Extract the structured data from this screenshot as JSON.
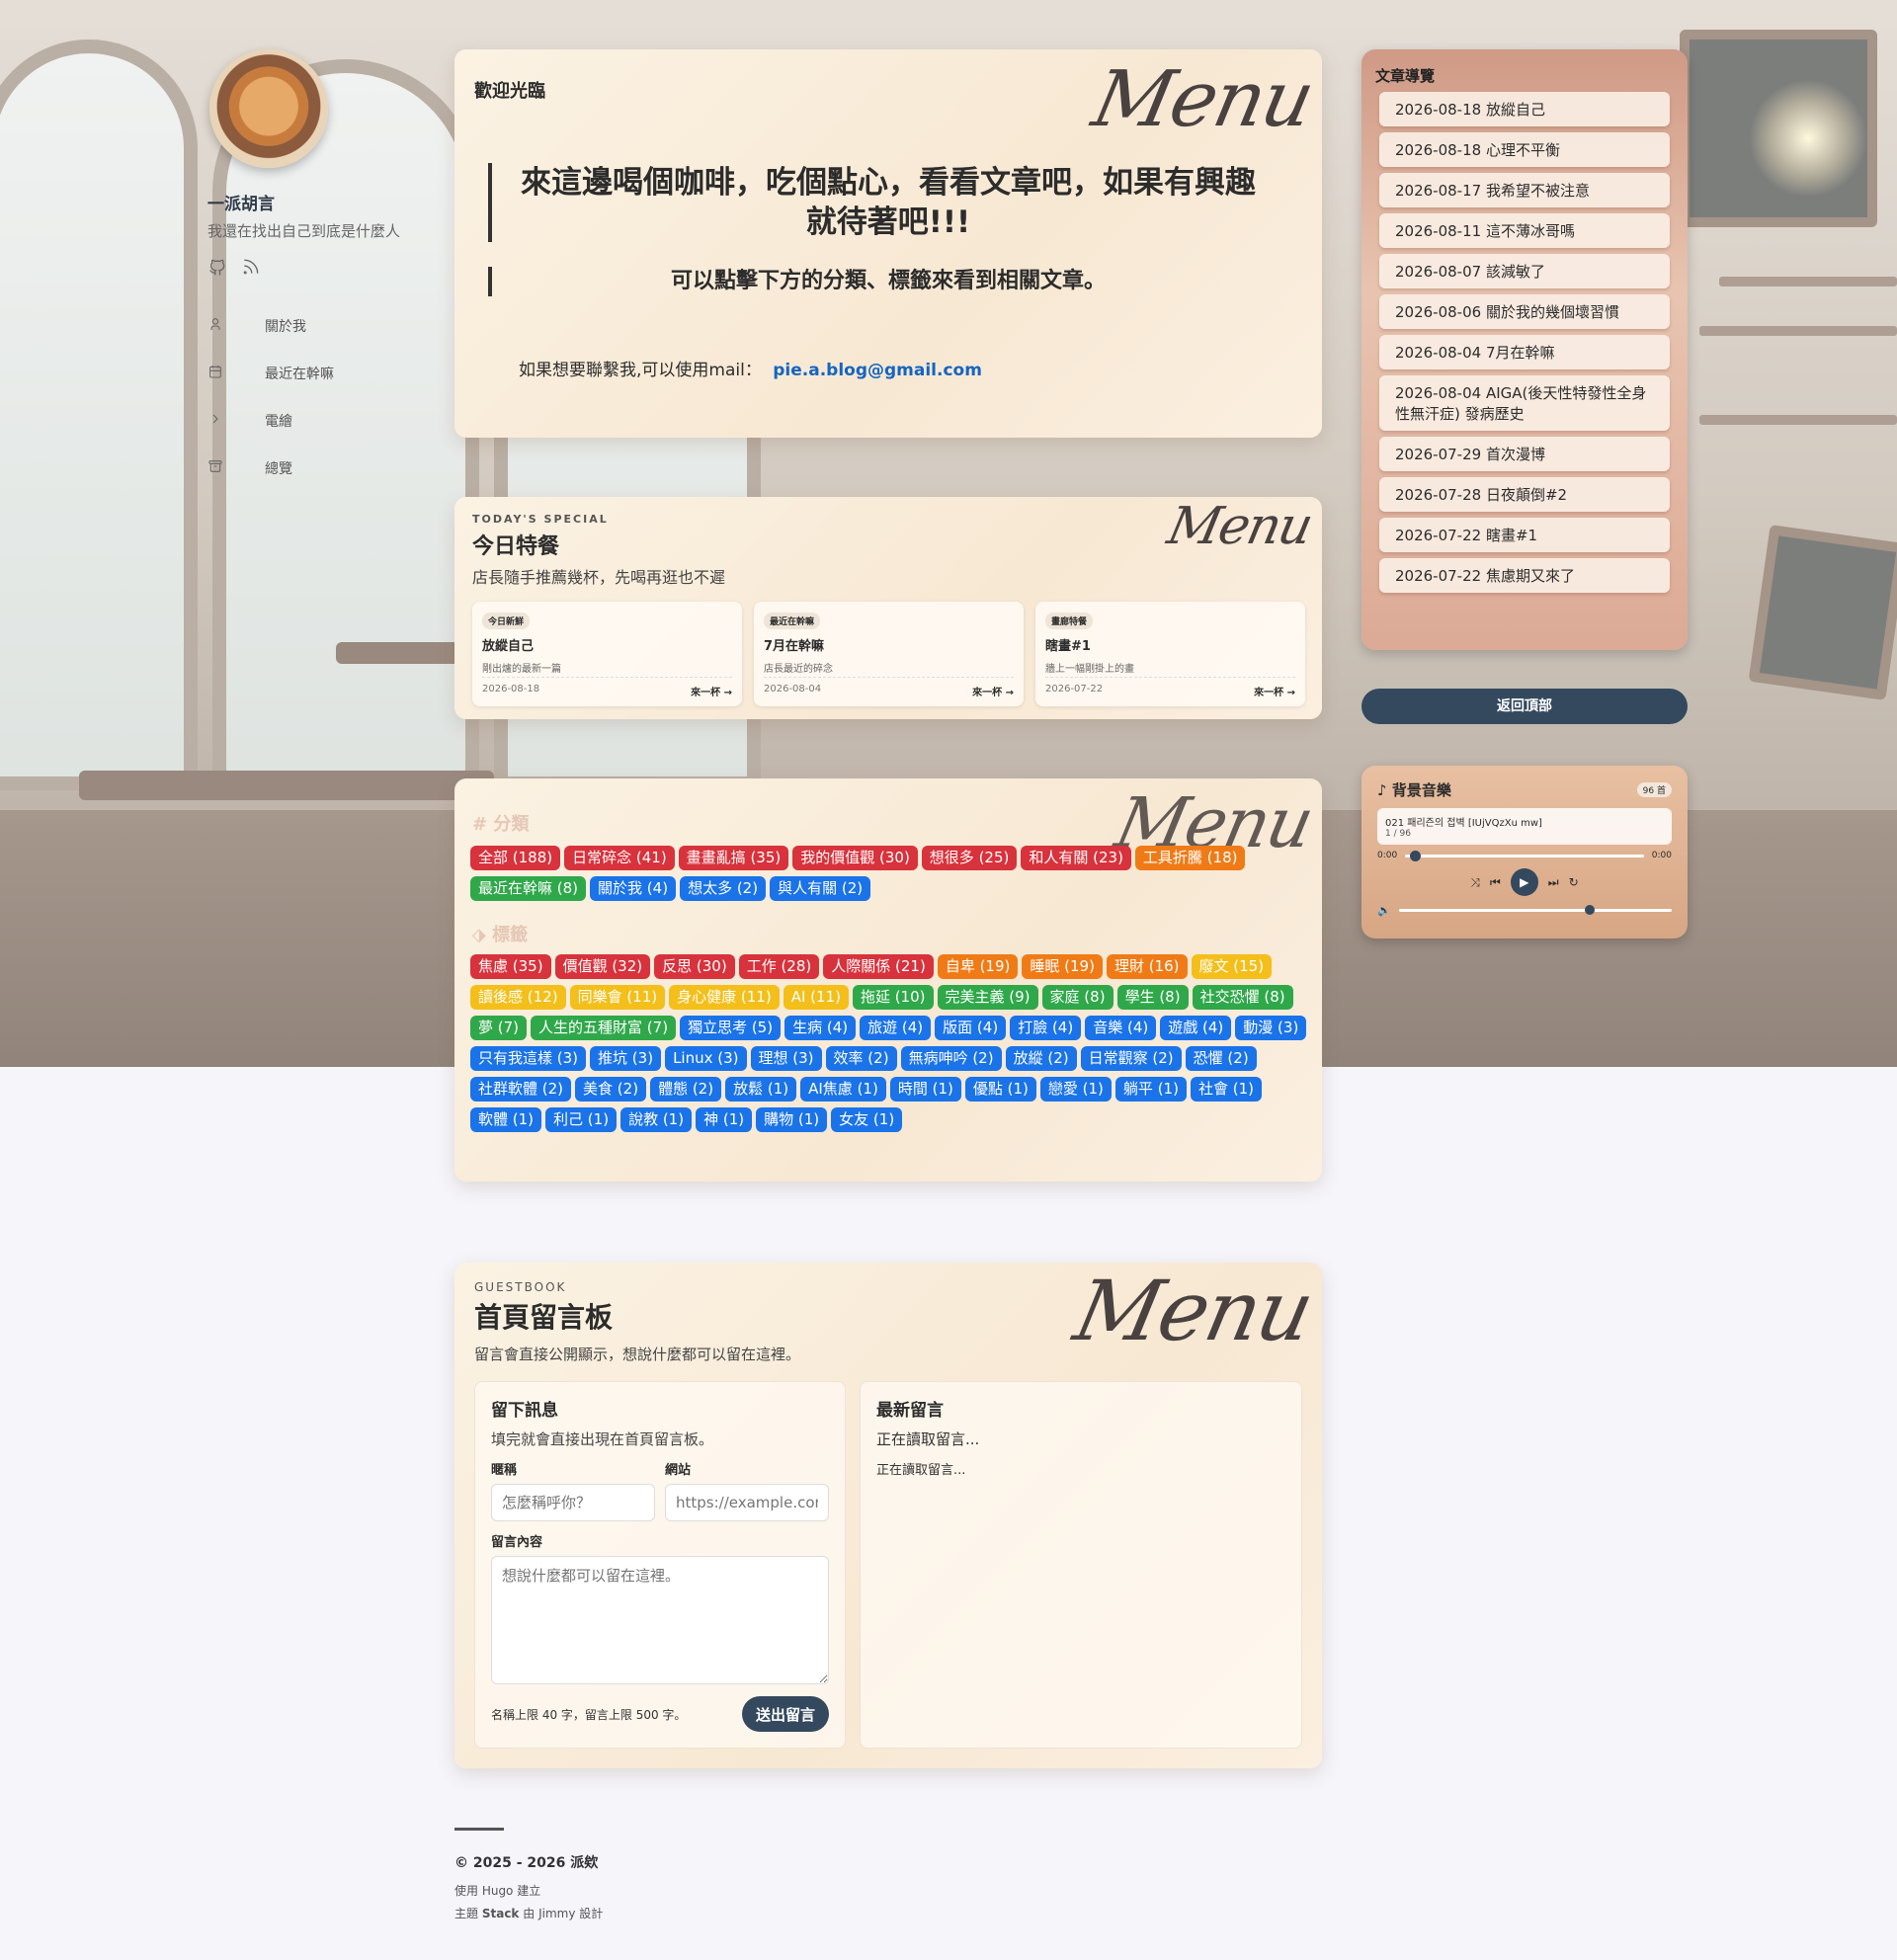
{
  "sidebar": {
    "site_name": "一派胡言",
    "site_desc": "我還在找出自己到底是什麼人",
    "nav": [
      {
        "label": "關於我",
        "icon": "user-icon"
      },
      {
        "label": "最近在幹嘛",
        "icon": "calendar-icon"
      },
      {
        "label": "電繪",
        "icon": "chevron-right-icon"
      },
      {
        "label": "總覽",
        "icon": "archive-icon"
      }
    ]
  },
  "welcome": {
    "title": "歡迎光臨",
    "menu_text": "Menu",
    "quote1": "來這邊喝個咖啡，吃個點心，看看文章吧，如果有興趣就待著吧!!!",
    "quote2": "可以點擊下方的分類、標籤來看到相關文章。",
    "contact_label": "如果想要聯繫我,可以使用mail：",
    "contact_email": "pie.a.blog@gmail.com"
  },
  "special": {
    "eyebrow": "TODAY'S SPECIAL",
    "title": "今日特餐",
    "subtitle": "店長隨手推薦幾杯，先喝再逛也不遲",
    "items": [
      {
        "badge": "今日新鮮",
        "title": "放縱自己",
        "desc": "剛出爐的最新一篇",
        "date": "2026-08-18",
        "more": "來一杯 →"
      },
      {
        "badge": "最近在幹嘛",
        "title": "7月在幹嘛",
        "desc": "店長最近的碎念",
        "date": "2026-08-04",
        "more": "來一杯 →"
      },
      {
        "badge": "畫廊特餐",
        "title": "瞎畫#1",
        "desc": "牆上一幅剛掛上的畫",
        "date": "2026-07-22",
        "more": "來一杯 →"
      }
    ]
  },
  "taxonomy": {
    "cat_heading": "分類",
    "tag_heading": "標籤",
    "categories": [
      {
        "label": "全部 (188)",
        "color": "red"
      },
      {
        "label": "日常碎念 (41)",
        "color": "red"
      },
      {
        "label": "畫畫亂搞 (35)",
        "color": "red"
      },
      {
        "label": "我的價值觀 (30)",
        "color": "red"
      },
      {
        "label": "想很多 (25)",
        "color": "red"
      },
      {
        "label": "和人有關 (23)",
        "color": "red"
      },
      {
        "label": "工具折騰 (18)",
        "color": "orange"
      },
      {
        "label": "最近在幹嘛 (8)",
        "color": "green"
      },
      {
        "label": "關於我 (4)",
        "color": "blue"
      },
      {
        "label": "想太多 (2)",
        "color": "blue"
      },
      {
        "label": "與人有關 (2)",
        "color": "blue"
      }
    ],
    "tags": [
      {
        "label": "焦慮 (35)",
        "color": "red"
      },
      {
        "label": "價值觀 (32)",
        "color": "red"
      },
      {
        "label": "反思 (30)",
        "color": "red"
      },
      {
        "label": "工作 (28)",
        "color": "red"
      },
      {
        "label": "人際關係 (21)",
        "color": "red"
      },
      {
        "label": "自卑 (19)",
        "color": "orange"
      },
      {
        "label": "睡眠 (19)",
        "color": "orange"
      },
      {
        "label": "理財 (16)",
        "color": "orange"
      },
      {
        "label": "廢文 (15)",
        "color": "yellow"
      },
      {
        "label": "讀後感 (12)",
        "color": "yellow"
      },
      {
        "label": "同樂會 (11)",
        "color": "yellow"
      },
      {
        "label": "身心健康 (11)",
        "color": "yellow"
      },
      {
        "label": "AI (11)",
        "color": "yellow"
      },
      {
        "label": "拖延 (10)",
        "color": "green"
      },
      {
        "label": "完美主義 (9)",
        "color": "green"
      },
      {
        "label": "家庭 (8)",
        "color": "green"
      },
      {
        "label": "學生 (8)",
        "color": "green"
      },
      {
        "label": "社交恐懼 (8)",
        "color": "green"
      },
      {
        "label": "夢 (7)",
        "color": "green"
      },
      {
        "label": "人生的五種財富 (7)",
        "color": "green"
      },
      {
        "label": "獨立思考 (5)",
        "color": "blue"
      },
      {
        "label": "生病 (4)",
        "color": "blue"
      },
      {
        "label": "旅遊 (4)",
        "color": "blue"
      },
      {
        "label": "版面 (4)",
        "color": "blue"
      },
      {
        "label": "打臉 (4)",
        "color": "blue"
      },
      {
        "label": "音樂 (4)",
        "color": "blue"
      },
      {
        "label": "遊戲 (4)",
        "color": "blue"
      },
      {
        "label": "動漫 (3)",
        "color": "blue"
      },
      {
        "label": "只有我這樣 (3)",
        "color": "blue"
      },
      {
        "label": "推坑 (3)",
        "color": "blue"
      },
      {
        "label": "Linux (3)",
        "color": "blue"
      },
      {
        "label": "理想 (3)",
        "color": "blue"
      },
      {
        "label": "效率 (2)",
        "color": "blue"
      },
      {
        "label": "無病呻吟 (2)",
        "color": "blue"
      },
      {
        "label": "放縱 (2)",
        "color": "blue"
      },
      {
        "label": "日常觀察 (2)",
        "color": "blue"
      },
      {
        "label": "恐懼 (2)",
        "color": "blue"
      },
      {
        "label": "社群軟體 (2)",
        "color": "blue"
      },
      {
        "label": "美食 (2)",
        "color": "blue"
      },
      {
        "label": "體態 (2)",
        "color": "blue"
      },
      {
        "label": "放鬆 (1)",
        "color": "blue"
      },
      {
        "label": "AI焦慮 (1)",
        "color": "blue"
      },
      {
        "label": "時間 (1)",
        "color": "blue"
      },
      {
        "label": "優點 (1)",
        "color": "blue"
      },
      {
        "label": "戀愛 (1)",
        "color": "blue"
      },
      {
        "label": "躺平 (1)",
        "color": "blue"
      },
      {
        "label": "社會 (1)",
        "color": "blue"
      },
      {
        "label": "軟體 (1)",
        "color": "blue"
      },
      {
        "label": "利己 (1)",
        "color": "blue"
      },
      {
        "label": "說教 (1)",
        "color": "blue"
      },
      {
        "label": "神 (1)",
        "color": "blue"
      },
      {
        "label": "購物 (1)",
        "color": "blue"
      },
      {
        "label": "女友 (1)",
        "color": "blue"
      }
    ]
  },
  "guestbook": {
    "eyebrow": "GUESTBOOK",
    "title": "首頁留言板",
    "subtitle": "留言會直接公開顯示，想說什麼都可以留在這裡。",
    "form_title": "留下訊息",
    "form_desc": "填完就會直接出現在首頁留言板。",
    "name_label": "暱稱",
    "name_placeholder": "怎麼稱呼你？",
    "site_label": "網站",
    "site_placeholder": "https://example.com",
    "content_label": "留言內容",
    "content_placeholder": "想說什麼都可以留在這裡。",
    "limit_note": "名稱上限 40 字，留言上限 500 字。",
    "submit": "送出留言",
    "latest_title": "最新留言",
    "latest_status": "正在讀取留言...",
    "latest_loading": "正在讀取留言..."
  },
  "toc": {
    "title": "文章導覽",
    "items": [
      "2026-08-18 放縱自己",
      "2026-08-18 心理不平衡",
      "2026-08-17 我希望不被注意",
      "2026-08-11 這不薄冰哥嗎",
      "2026-08-07 該減敏了",
      "2026-08-06 關於我的幾個壞習慣",
      "2026-08-04 7月在幹嘛",
      "2026-08-04 AIGA(後天性特發性全身性無汗症) 發病歷史",
      "2026-07-29 首次漫博",
      "2026-07-28 日夜顛倒#2",
      "2026-07-22 瞎畫#1",
      "2026-07-22 焦慮期又來了"
    ]
  },
  "back_to_top": "返回頂部",
  "music": {
    "title": "背景音樂",
    "count": "96 首",
    "track": "021 패리즌의 접벽 [IUjVQzXu mw]",
    "index": "1 / 96",
    "time_current": "0:00",
    "time_total": "0:00",
    "progress": 0.02,
    "volume": 0.7
  },
  "footer": {
    "copyright": "© 2025 - 2026 派欸",
    "built_with": "使用 Hugo 建立",
    "theme_prefix": "主題",
    "theme_name": "Stack",
    "theme_mid": "由",
    "theme_author": "Jimmy",
    "theme_suffix": "設計"
  },
  "colors": {
    "red": "#d8323c",
    "orange": "#f07b16",
    "yellow": "#f4bf1a",
    "green": "#2fa84a",
    "blue": "#1a73e8",
    "accent_dark": "#34495e",
    "link": "#1565c0"
  }
}
